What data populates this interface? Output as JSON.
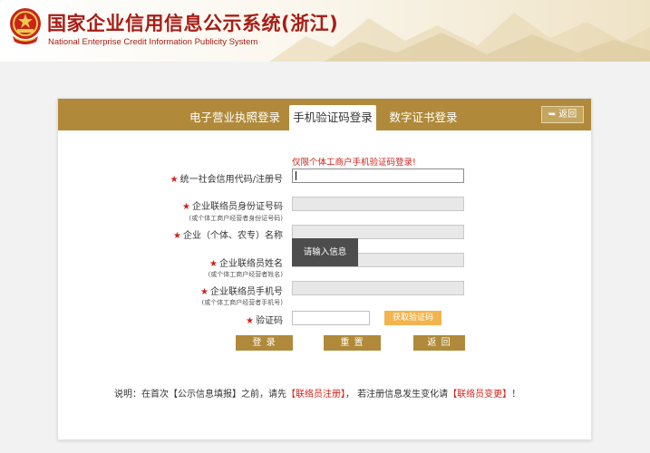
{
  "header": {
    "title_cn": "国家企业信用信息公示系统(浙江)",
    "title_en": "National Enterprise Credit Information Publicity System"
  },
  "tabs": [
    {
      "label": "电子营业执照登录",
      "active": false
    },
    {
      "label": "手机验证码登录",
      "active": true
    },
    {
      "label": "数字证书登录",
      "active": false
    }
  ],
  "back_button": {
    "label": "返回",
    "icon": "back-arrow-icon"
  },
  "notice": "仅限个体工商户手机验证码登录!",
  "form": {
    "credit_code": {
      "label": "统一社会信用代码/注册号",
      "value": ""
    },
    "id_number": {
      "label": "企业联络员身份证号码",
      "hint": "(或个体工商户经营者身份证号码)",
      "value": ""
    },
    "company_name": {
      "label": "企业（个体、农专）名称",
      "value": ""
    },
    "liaison_name": {
      "label": "企业联络员姓名",
      "hint": "(或个体工商户经营者姓名)",
      "value": ""
    },
    "phone": {
      "label": "企业联络员手机号",
      "hint": "(或个体工商户经营者手机号)",
      "value": ""
    },
    "code": {
      "label": "验证码",
      "value": ""
    }
  },
  "tooltip": "请输入信息",
  "get_code_label": "获取验证码",
  "buttons": {
    "login": "登 录",
    "reset": "重 置",
    "back": "返 回"
  },
  "footnote": {
    "prefix": "说明：在首次【公示信息填报】之前，请先",
    "link1": "【联络员注册】",
    "middle": "， 若注册信息发生变化请",
    "link2": "【联络员变更】",
    "suffix": "！"
  },
  "colors": {
    "brand": "#b08a3a",
    "title_red": "#a81d15",
    "alert_red": "#d0221b",
    "accent_orange": "#f2b44c"
  }
}
